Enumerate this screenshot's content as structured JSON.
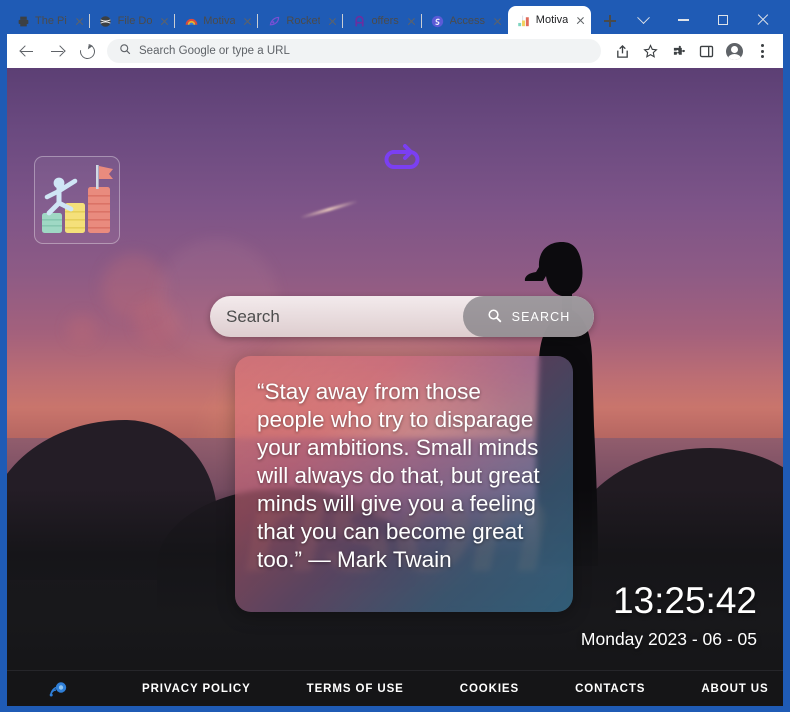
{
  "browser": {
    "tabs": [
      {
        "title": "The Pi",
        "icon": "printer-icon",
        "icon_glyph": "▤",
        "icon_color": "#3c4043",
        "active": false
      },
      {
        "title": "File Do",
        "icon": "globe-icon",
        "icon_glyph": "⊕",
        "icon_color": "#3c4043",
        "active": false
      },
      {
        "title": "Motiva",
        "icon": "rainbow-icon",
        "icon_glyph": "◠",
        "icon_color": "#d9534f",
        "active": false
      },
      {
        "title": "Rocket",
        "icon": "comet-icon",
        "icon_glyph": "✦",
        "icon_color": "#7b4fd4",
        "active": false
      },
      {
        "title": "offers",
        "icon": "letter-a-icon",
        "icon_glyph": "A",
        "icon_color": "#6b2fa0",
        "active": false
      },
      {
        "title": "Access",
        "icon": "spiral-icon",
        "icon_glyph": "◎",
        "icon_color": "#5b5bd6",
        "active": false
      },
      {
        "title": "Motiva",
        "icon": "stairs-icon",
        "icon_glyph": "▯",
        "icon_color": "#e06b5a",
        "active": true
      }
    ],
    "new_tab_label": "+",
    "window_controls": {
      "tab_search": "chevron-down-icon",
      "minimize": "minimize-icon",
      "maximize": "maximize-icon",
      "close": "close-icon"
    },
    "toolbar": {
      "back": "back-arrow-icon",
      "forward": "forward-arrow-icon",
      "reload": "reload-icon",
      "omnibox_placeholder": "Search Google or type a URL",
      "omnibox_value": "",
      "actions": [
        {
          "name": "share-icon",
          "glyph": "⇪"
        },
        {
          "name": "bookmark-star-icon",
          "glyph": "☆"
        },
        {
          "name": "extensions-puzzle-icon",
          "glyph": "🧩"
        },
        {
          "name": "side-panel-icon",
          "glyph": "▯"
        },
        {
          "name": "profile-avatar",
          "glyph": ""
        },
        {
          "name": "chrome-menu-icon",
          "glyph": "⋮"
        }
      ]
    },
    "theme_color": "#1f5bb5"
  },
  "page": {
    "logo_alt": "stick-figure-climbing-steps-to-flag",
    "reload_quote_icon": "loop-arrow-icon",
    "reload_quote_color": "#7b3ff2",
    "watermark_text": "rison",
    "search": {
      "placeholder": "Search",
      "value": "",
      "button_label": "SEARCH",
      "button_icon": "search-icon"
    },
    "quote": {
      "text": "“Stay away from those people who try to disparage your ambitions. Small minds will always do that, but great minds will give you a feeling that you can become great too.” — Mark Twain",
      "author": "Mark Twain"
    },
    "clock": {
      "time": "13:25:42",
      "date": "Monday 2023 - 06 - 05"
    },
    "footer": {
      "logo_name": "site-logo-icon",
      "links": [
        {
          "label": "PRIVACY POLICY"
        },
        {
          "label": "TERMS OF USE"
        },
        {
          "label": "COOKIES"
        },
        {
          "label": "CONTACTS"
        },
        {
          "label": "ABOUT US"
        }
      ]
    },
    "colors": {
      "sky_top": "#5c3f74",
      "sky_mid": "#a4617c",
      "sky_sunset": "#c9756c",
      "footer_bg": "#151517",
      "accent_purple": "#7b3ff2",
      "footer_icon_blue": "#2f7fd8"
    }
  }
}
